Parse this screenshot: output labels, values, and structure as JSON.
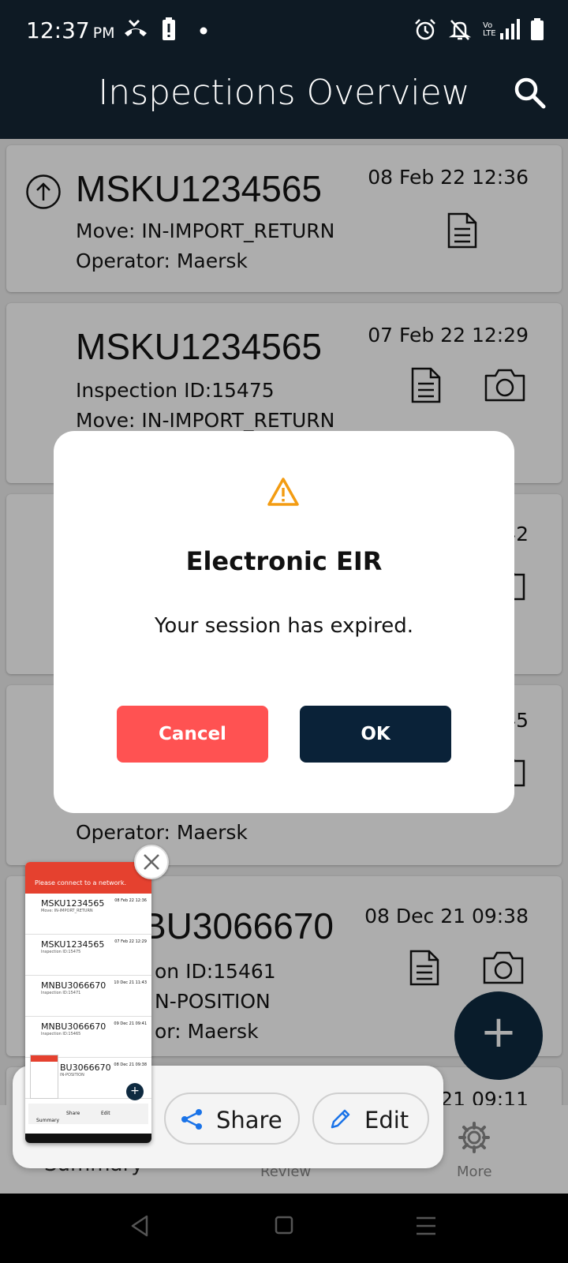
{
  "status_bar": {
    "time": "12:37",
    "ampm": "PM",
    "network": "Vo LTE"
  },
  "app_bar": {
    "title": "Inspections Overview"
  },
  "list": [
    {
      "container_id": "MSKU1234565",
      "lines": [
        "Move: IN-IMPORT_RETURN",
        "Operator: Maersk"
      ],
      "date": "08 Feb 22 12:36"
    },
    {
      "container_id": "MSKU1234565",
      "lines": [
        "Inspection ID:15475",
        "Move: IN-IMPORT_RETURN"
      ],
      "date": "07 Feb 22 12:29"
    },
    {
      "date_fragment": "42"
    },
    {
      "date_fragment": "45",
      "lines": [
        "Operator: Maersk"
      ]
    },
    {
      "container_id_fragment": "BU3066670",
      "lines": [
        "on ID:15461",
        "N-POSITION",
        "or: Maersk"
      ],
      "date": "08 Dec 21 09:38"
    },
    {
      "date_fragment": "ec 21 09:11"
    }
  ],
  "dialog": {
    "title": "Electronic EIR",
    "message": "Your session has expired.",
    "cancel_label": "Cancel",
    "ok_label": "OK"
  },
  "bottom_nav": {
    "summary": "Summary",
    "review": "Review",
    "more": "More"
  },
  "screenshot_actions": {
    "share": "Share",
    "edit": "Edit"
  },
  "thumbnail": {
    "banner": "Please connect to a network.",
    "rows": [
      {
        "id": "MSKU1234565",
        "date": "08 Feb 22 12:36",
        "sub": "Move: IN-IMPORT_RETURN"
      },
      {
        "id": "MSKU1234565",
        "date": "07 Feb 22 12:29",
        "sub": "Inspection ID:15475"
      },
      {
        "id": "MNBU3066670",
        "date": "10 Dec 21 11:43",
        "sub": "Inspection ID:15471"
      },
      {
        "id": "MNBU3066670",
        "date": "09 Dec 21 09:41",
        "sub": "Inspection ID:15465"
      },
      {
        "id": "BU3066670",
        "date": "08 Dec 21 09:38",
        "sub": "IN-POSITION"
      }
    ],
    "share": "Share",
    "edit": "Edit",
    "summary": "Summary"
  },
  "colors": {
    "appbar": "#0e1a24",
    "cancel": "#ff5252",
    "ok": "#0a2238",
    "warning": "#f39c12"
  }
}
